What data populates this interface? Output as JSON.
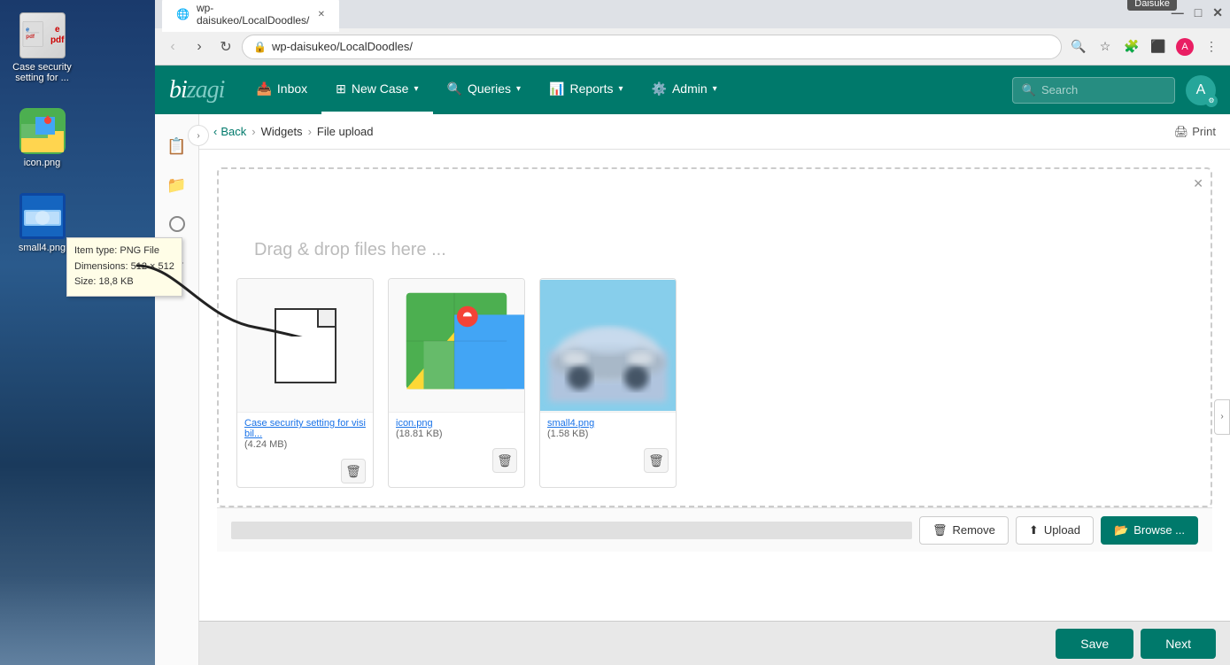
{
  "desktop": {
    "icons": [
      {
        "id": "case-security",
        "label": "Case security setting for ...",
        "type": "pdf"
      },
      {
        "id": "icon-png",
        "label": "icon.png",
        "type": "maps"
      },
      {
        "id": "small4-png",
        "label": "small4.png",
        "type": "small4"
      }
    ]
  },
  "tooltip": {
    "line1": "Item type: PNG File",
    "line2": "Dimensions: 512 × 512",
    "line3": "Size: 18,8 KB"
  },
  "browser": {
    "tab_title": "wp-daisukeo/LocalDoodles/",
    "address": "wp-daisukeo/LocalDoodles/",
    "daisuke_label": "Daisuke"
  },
  "app": {
    "logo": "bizagi",
    "nav": {
      "items": [
        {
          "id": "inbox",
          "label": "Inbox",
          "icon": "📥"
        },
        {
          "id": "new-case",
          "label": "New Case",
          "icon": "➕",
          "active": true,
          "has_dropdown": true
        },
        {
          "id": "queries",
          "label": "Queries",
          "icon": "🔍",
          "has_dropdown": true
        },
        {
          "id": "reports",
          "label": "Reports",
          "icon": "📊",
          "has_dropdown": true
        },
        {
          "id": "admin",
          "label": "Admin",
          "icon": "⚙️",
          "has_dropdown": true
        }
      ],
      "search_placeholder": "Search",
      "user_initial": "A"
    },
    "sidebar": {
      "items": [
        {
          "id": "notes",
          "icon": "📋"
        },
        {
          "id": "folder",
          "icon": "📁"
        },
        {
          "id": "circle",
          "icon": "⭕"
        },
        {
          "id": "network",
          "icon": "🔗"
        }
      ]
    },
    "breadcrumb": {
      "back_label": "Back",
      "widgets_label": "Widgets",
      "separator": "›",
      "current_label": "File upload"
    },
    "print_label": "Print",
    "drop_zone": {
      "label": "Drag & drop files here ...",
      "files": [
        {
          "id": "case-security-file",
          "name": "Case security setting for visibil...",
          "size": "(4.24 MB)",
          "type": "document"
        },
        {
          "id": "icon-png-file",
          "name": "icon.png",
          "size": "(18.81 KB)",
          "type": "maps"
        },
        {
          "id": "small4-png-file",
          "name": "small4.png",
          "size": "(1.58 KB)",
          "type": "image"
        }
      ]
    },
    "toolbar": {
      "remove_label": "Remove",
      "upload_label": "Upload",
      "browse_label": "Browse ..."
    },
    "actions": {
      "save_label": "Save",
      "next_label": "Next"
    }
  }
}
